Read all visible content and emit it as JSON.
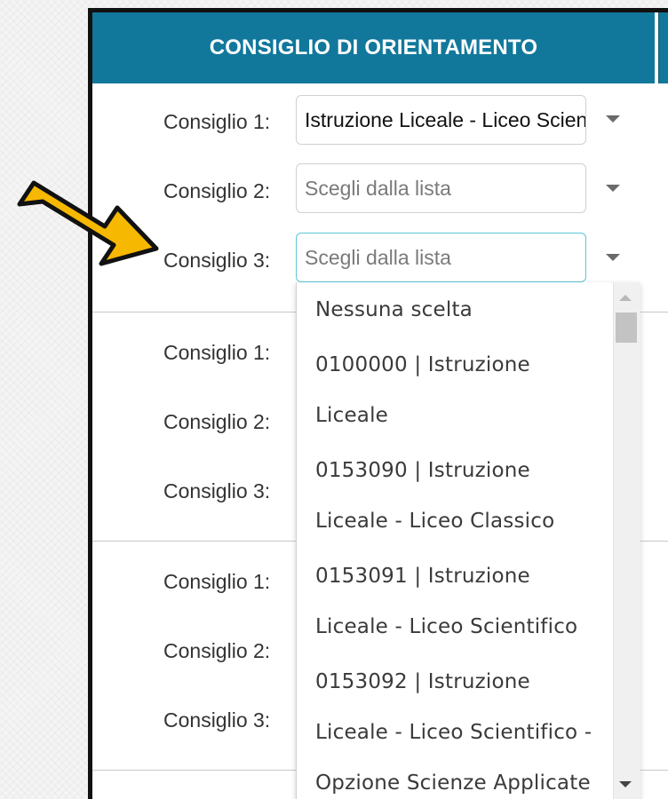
{
  "header": {
    "title": "CONSIGLIO DI ORIENTAMENTO"
  },
  "sections": [
    {
      "rows": [
        {
          "label": "Consiglio 1:",
          "value": "Istruzione Liceale - Liceo Scientifico",
          "state": "filled"
        },
        {
          "label": "Consiglio 2:",
          "value": "Scegli dalla lista",
          "state": "placeholder"
        },
        {
          "label": "Consiglio 3:",
          "value": "Scegli dalla lista",
          "state": "focused"
        }
      ]
    },
    {
      "rows": [
        {
          "label": "Consiglio 1:"
        },
        {
          "label": "Consiglio 2:"
        },
        {
          "label": "Consiglio 3:"
        }
      ]
    },
    {
      "rows": [
        {
          "label": "Consiglio 1:"
        },
        {
          "label": "Consiglio 2:"
        },
        {
          "label": "Consiglio 3:"
        }
      ]
    }
  ],
  "dropdown": {
    "options": [
      {
        "lines": [
          "Nessuna scelta"
        ]
      },
      {
        "lines": [
          "0100000 | Istruzione",
          "Liceale"
        ]
      },
      {
        "lines": [
          "0153090 | Istruzione",
          "Liceale - Liceo Classico"
        ]
      },
      {
        "lines": [
          "0153091 | Istruzione",
          "Liceale - Liceo Scientifico"
        ]
      },
      {
        "lines": [
          "0153092 | Istruzione",
          "Liceale - Liceo Scientifico -",
          "Opzione Scienze Applicate"
        ]
      }
    ]
  },
  "colors": {
    "header_bg": "#11789b",
    "focus_border": "#5cc7d9",
    "pointer_arrow": "#f6b800"
  },
  "icons": {
    "pointer": "arrow-pointer-icon",
    "caret": "chevron-down-icon"
  }
}
